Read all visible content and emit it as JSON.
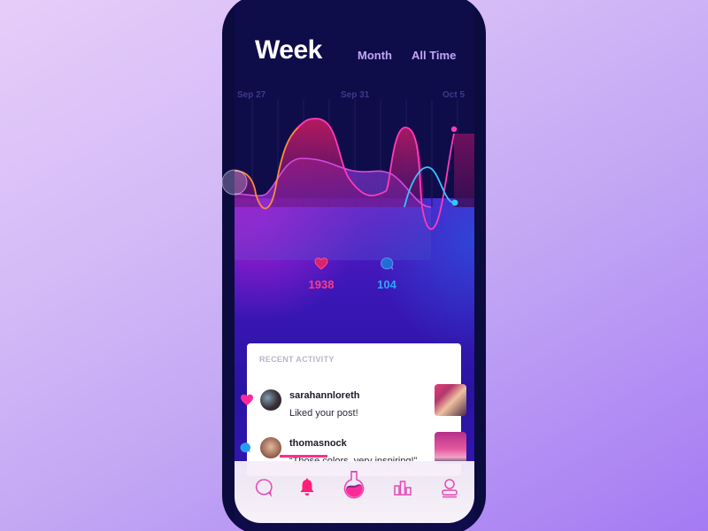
{
  "header": {
    "active_period": "Week",
    "tabs": [
      {
        "label": "Week",
        "active": true
      },
      {
        "label": "Month",
        "active": false
      },
      {
        "label": "All Time",
        "active": false
      }
    ]
  },
  "chart": {
    "date_labels": [
      "Sep 27",
      "Sep 31",
      "Oct 5"
    ],
    "colors": {
      "likes_line": "#ff3bb0",
      "comments_line": "#2ec6ff",
      "secondary_line": "#ff7a3a",
      "accent_fill": "#b31a6a"
    }
  },
  "stats": {
    "likes": {
      "value": "1938",
      "icon": "heart-icon",
      "color": "#ff3b8b"
    },
    "comments": {
      "value": "104",
      "icon": "chat-bubble-icon",
      "color": "#2aa7ff"
    }
  },
  "recent_activity": {
    "title": "RECENT ACTIVITY",
    "items": [
      {
        "username": "sarahannloreth",
        "message": "Liked your post!",
        "type": "like"
      },
      {
        "username": "thomasnock",
        "message": "“Those colors, very inspiring!”",
        "type": "comment"
      }
    ]
  },
  "tabbar": {
    "items": [
      {
        "name": "chat",
        "icon": "chat-icon",
        "active": false
      },
      {
        "name": "notifications",
        "icon": "bell-icon",
        "active": true
      },
      {
        "name": "lab",
        "icon": "flask-icon",
        "active": false
      },
      {
        "name": "stats",
        "icon": "bar-chart-icon",
        "active": false
      },
      {
        "name": "profile",
        "icon": "user-icon",
        "active": false
      }
    ]
  }
}
